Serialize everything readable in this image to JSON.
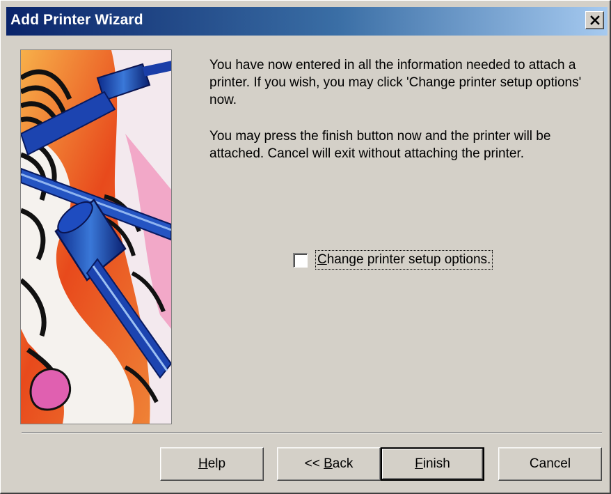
{
  "window": {
    "title": "Add Printer Wizard",
    "close_icon": "close-icon"
  },
  "content": {
    "paragraph1": "You have now entered in all the information needed to attach a printer.  If you wish, you may click 'Change printer setup options' now.",
    "paragraph2": "You may press the finish button now and the printer will be attached.  Cancel will exit without attaching the printer.",
    "checkbox": {
      "label_mnemonic": "C",
      "label_rest": "hange printer setup options.",
      "checked": false
    }
  },
  "buttons": {
    "help": {
      "mnemonic": "H",
      "rest": "elp"
    },
    "back": {
      "prefix": "<< ",
      "mnemonic": "B",
      "rest": "ack"
    },
    "finish": {
      "mnemonic": "F",
      "rest": "inish"
    },
    "cancel": {
      "label": "Cancel"
    }
  },
  "colors": {
    "dialog_bg": "#d4d0c8",
    "title_gradient_start": "#0a246a",
    "title_gradient_end": "#a6caf0"
  }
}
